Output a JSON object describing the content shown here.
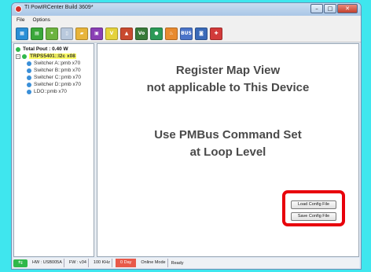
{
  "window": {
    "title": "TI PowIRCenter Build 3609*",
    "controls": [
      "–",
      "□",
      "✕"
    ]
  },
  "menu": [
    "File",
    "Options"
  ],
  "toolbar": {
    "icons": [
      {
        "name": "register-map-icon",
        "color": "#2a8fd6",
        "glyph": "▦"
      },
      {
        "name": "layout-icon",
        "color": "#3aa83a",
        "glyph": "▤"
      },
      {
        "name": "tree-icon",
        "color": "#6cb33f",
        "glyph": "✦"
      },
      {
        "name": "document-icon",
        "color": "#b9c9dd",
        "glyph": "▯"
      },
      {
        "name": "folder-open-icon",
        "color": "#e8b43a",
        "glyph": "▰"
      },
      {
        "name": "save-icon",
        "color": "#8a3fb5",
        "glyph": "▣"
      },
      {
        "name": "vout-graph-icon",
        "color": "#e5d23a",
        "glyph": "V"
      },
      {
        "name": "chart-icon",
        "color": "#c94a2f",
        "glyph": "▲"
      },
      {
        "name": "vout-icon",
        "color": "#3a7a3a",
        "glyph": "Vo"
      },
      {
        "name": "fault-icon",
        "color": "#2b9a57",
        "glyph": "●"
      },
      {
        "name": "temperature-icon",
        "color": "#e88a2e",
        "glyph": "♨"
      },
      {
        "name": "bus-icon",
        "color": "#4a74c9",
        "glyph": "BUS"
      },
      {
        "name": "monitor-icon",
        "color": "#3a6ab8",
        "glyph": "◙"
      },
      {
        "name": "help-lifebuoy-icon",
        "color": "#d23a3a",
        "glyph": "✚"
      }
    ]
  },
  "tree": {
    "total": "Total Pout : 0.40 W",
    "device": "TRPS5401::I2c x08",
    "children": [
      "Switcher A::pmb x70",
      "Switcher B::pmb x70",
      "Switcher C::pmb x70",
      "Switcher D::pmb x70",
      "LDO::pmb x70"
    ],
    "colors": {
      "total": "#2fb84a",
      "device": "#2fb84a",
      "child": "#3a8fd8"
    }
  },
  "main": {
    "message_line1": "Register Map View",
    "message_line2": "not applicable to This Device",
    "message_line3": "Use PMBus Command Set",
    "message_line4": "at Loop Level",
    "load_button": "Load Config File",
    "save_button": "Save Config File"
  },
  "status": {
    "hw": "HW : USB005A",
    "fw": "FW : v34",
    "freq": "100 KHz",
    "alert": "0 Day",
    "mode": "Online Mode",
    "state": "Ready"
  }
}
